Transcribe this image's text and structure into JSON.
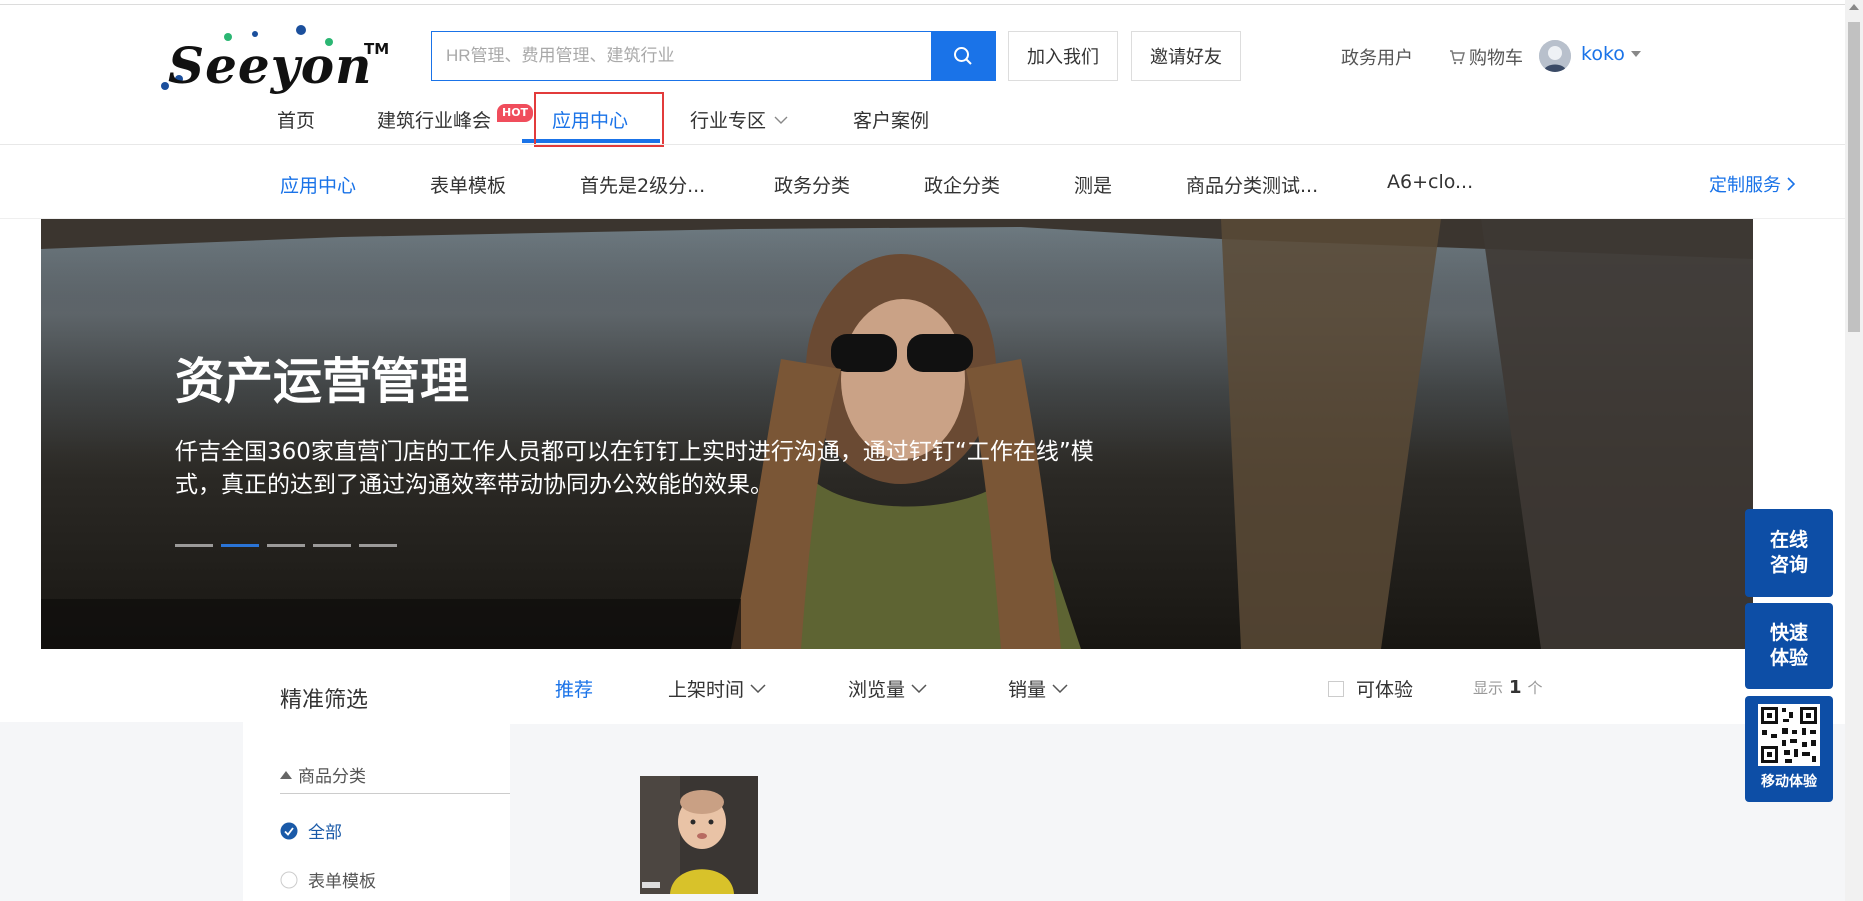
{
  "header": {
    "logo_text": "Seeyon",
    "logo_tm": "TM",
    "search_placeholder": "HR管理、费用管理、建筑行业",
    "join_label": "加入我们",
    "invite_label": "邀请好友",
    "gov_user_label": "政务用户",
    "cart_label": "购物车",
    "username": "koko"
  },
  "main_nav": {
    "items": [
      "首页",
      "建筑行业峰会",
      "应用中心",
      "行业专区",
      "客户案例"
    ],
    "hot_badge": "HOT"
  },
  "sub_nav": {
    "items": [
      "应用中心",
      "表单模板",
      "首先是2级分...",
      "政务分类",
      "政企分类",
      "测是",
      "商品分类测试...",
      "A6+clo..."
    ],
    "custom_service": "定制服务"
  },
  "banner": {
    "title": "资产运营管理",
    "description": "仟吉全国360家直营门店的工作人员都可以在钉钉上实时进行沟通，通过钉钉“工作在线”模式，真正的达到了通过沟通效率带动协同办公效能的效果。",
    "slide_count": 5,
    "active_slide": 2
  },
  "filter": {
    "title": "精准筛选",
    "category_label": "商品分类",
    "options": [
      {
        "label": "全部",
        "checked": true
      },
      {
        "label": "表单模板",
        "checked": false
      }
    ]
  },
  "sort_bar": {
    "recommend": "推荐",
    "listing_time": "上架时间",
    "views": "浏览量",
    "sales": "销量",
    "trial_label": "可体验",
    "display_label": "显示",
    "display_count": "1",
    "display_unit": "个"
  },
  "float_panel": {
    "consult_line1": "在线",
    "consult_line2": "咨询",
    "trial_line1": "快速",
    "trial_line2": "体验",
    "mobile_label": "移动体验"
  },
  "colors": {
    "primary": "#1a73e8",
    "float_bg": "#0d4ea6",
    "hot_badge": "#f04d5c",
    "highlight_box": "#e23b3b"
  }
}
